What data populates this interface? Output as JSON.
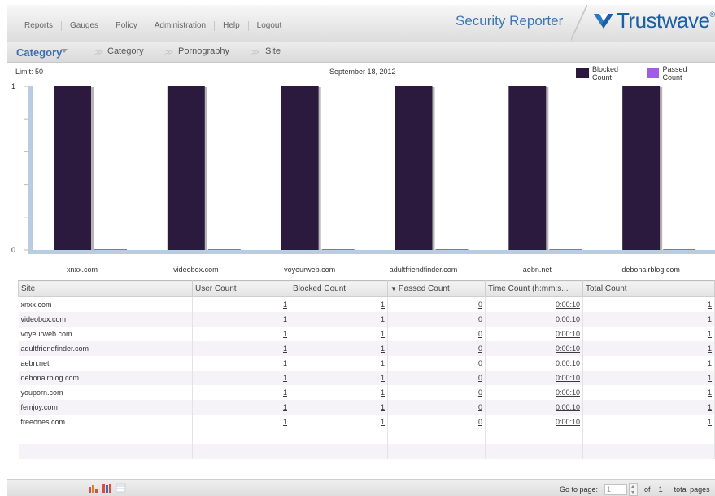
{
  "menu": {
    "items": [
      "Reports",
      "Gauges",
      "Policy",
      "Administration",
      "Help",
      "Logout"
    ]
  },
  "app_title": "Security Reporter",
  "logo": {
    "text": "Trustwave",
    "mark": "®"
  },
  "breadcrumb": {
    "current": "Category",
    "links": [
      "Category",
      "Pornography",
      "Site"
    ]
  },
  "chart_header": {
    "limit": "Limit: 50",
    "date": "September 18, 2012"
  },
  "colors": {
    "blocked": "#2c1a3e",
    "passed": "#a05de0",
    "axis": "#b8cde0"
  },
  "chart_data": {
    "type": "bar",
    "categories": [
      "xnxx.com",
      "videobox.com",
      "voyeurweb.com",
      "adultfriendfinder.com",
      "aebn.net",
      "debonairblog.com"
    ],
    "series": [
      {
        "name": "Blocked Count",
        "values": [
          1,
          1,
          1,
          1,
          1,
          1
        ]
      },
      {
        "name": "Passed Count",
        "values": [
          0,
          0,
          0,
          0,
          0,
          0
        ]
      }
    ],
    "ylim": [
      0,
      1
    ],
    "yticks": [
      "1",
      "0"
    ],
    "legend": "top-right"
  },
  "table": {
    "columns": [
      "Site",
      "User Count",
      "Blocked Count",
      "Passed Count",
      "Time Count (h:mm:s...",
      "Total Count"
    ],
    "sort_indicator": "▼",
    "rows": [
      [
        "xnxx.com",
        "1",
        "1",
        "0",
        "0:00:10",
        "1"
      ],
      [
        "videobox.com",
        "1",
        "1",
        "0",
        "0:00:10",
        "1"
      ],
      [
        "voyeurweb.com",
        "1",
        "1",
        "0",
        "0:00:10",
        "1"
      ],
      [
        "adultfriendfinder.com",
        "1",
        "1",
        "0",
        "0:00:10",
        "1"
      ],
      [
        "aebn.net",
        "1",
        "1",
        "0",
        "0:00:10",
        "1"
      ],
      [
        "debonairblog.com",
        "1",
        "1",
        "0",
        "0:00:10",
        "1"
      ],
      [
        "youporn.com",
        "1",
        "1",
        "0",
        "0:00:10",
        "1"
      ],
      [
        "femjoy.com",
        "1",
        "1",
        "0",
        "0:00:10",
        "1"
      ],
      [
        "freeones.com",
        "1",
        "1",
        "0",
        "0:00:10",
        "1"
      ]
    ]
  },
  "pager": {
    "go_label": "Go to page:",
    "page_value": "1",
    "of_label": "of",
    "total": "1",
    "total_label": "total pages"
  },
  "view_icons": [
    "bar-chart-view-icon",
    "stacked-chart-view-icon",
    "table-view-icon"
  ]
}
